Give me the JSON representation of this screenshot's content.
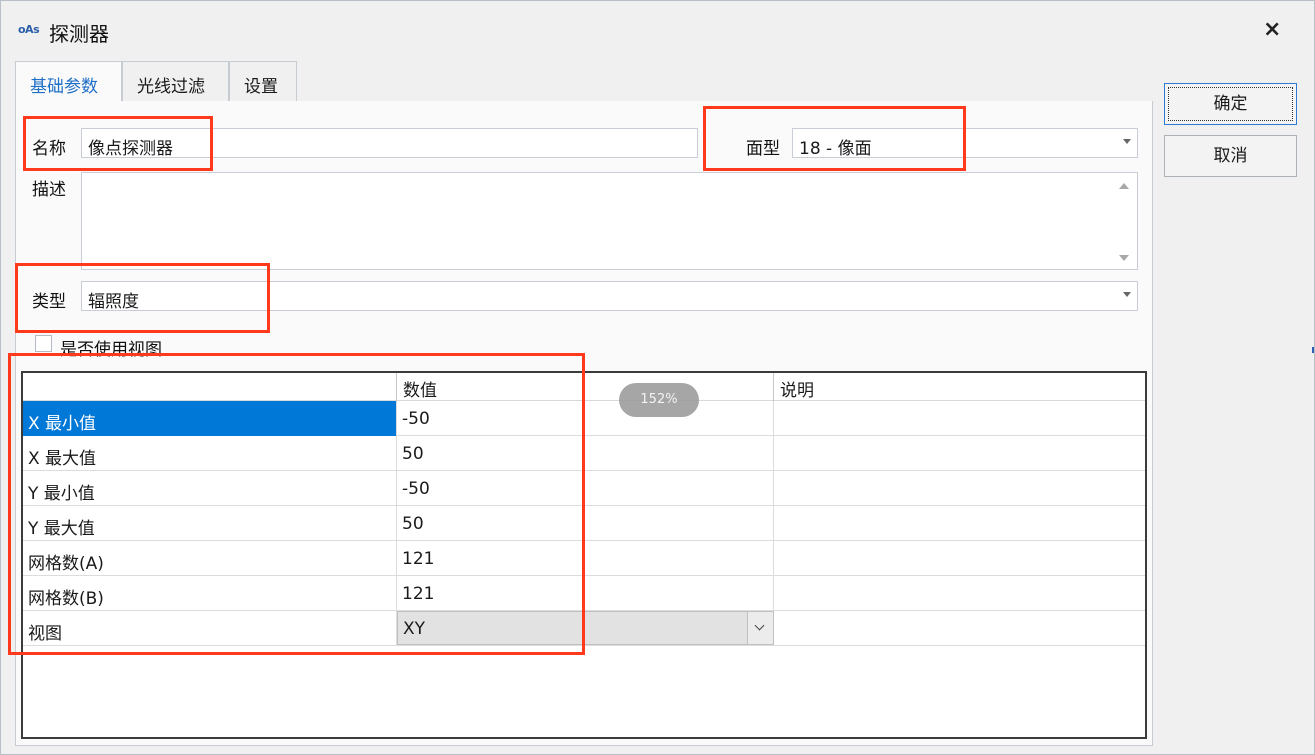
{
  "window": {
    "logo_text": "oAs",
    "title": "探测器",
    "close_glyph": "×"
  },
  "tabs": [
    {
      "label": "基础参数",
      "active": true
    },
    {
      "label": "光线过滤",
      "active": false
    },
    {
      "label": "设置",
      "active": false
    }
  ],
  "form": {
    "name_label": "名称",
    "name_value": "像点探测器",
    "surface_label": "面型",
    "surface_value": "18 - 像面",
    "desc_label": "描述",
    "desc_value": "",
    "type_label": "类型",
    "type_value": "辐照度",
    "use_view_label": "是否使用视图",
    "use_view_checked": false
  },
  "grid": {
    "columns": [
      "",
      "数值",
      "说明"
    ],
    "rows": [
      {
        "param": "X 最小值",
        "value": "-50",
        "note": ""
      },
      {
        "param": "X 最大值",
        "value": "50",
        "note": ""
      },
      {
        "param": "Y 最小值",
        "value": "-50",
        "note": ""
      },
      {
        "param": "Y 最大值",
        "value": "50",
        "note": ""
      },
      {
        "param": "网格数(A)",
        "value": "121",
        "note": ""
      },
      {
        "param": "网格数(B)",
        "value": "121",
        "note": ""
      },
      {
        "param": "视图",
        "value": "XY",
        "note": ""
      }
    ],
    "selected_row": 0
  },
  "zoom_indicator": "152%",
  "buttons": {
    "ok": "确定",
    "cancel": "取消"
  },
  "colors": {
    "accent": "#0078d7",
    "highlight_box": "#ff3a1c",
    "active_tab_text": "#1e6fc7"
  }
}
